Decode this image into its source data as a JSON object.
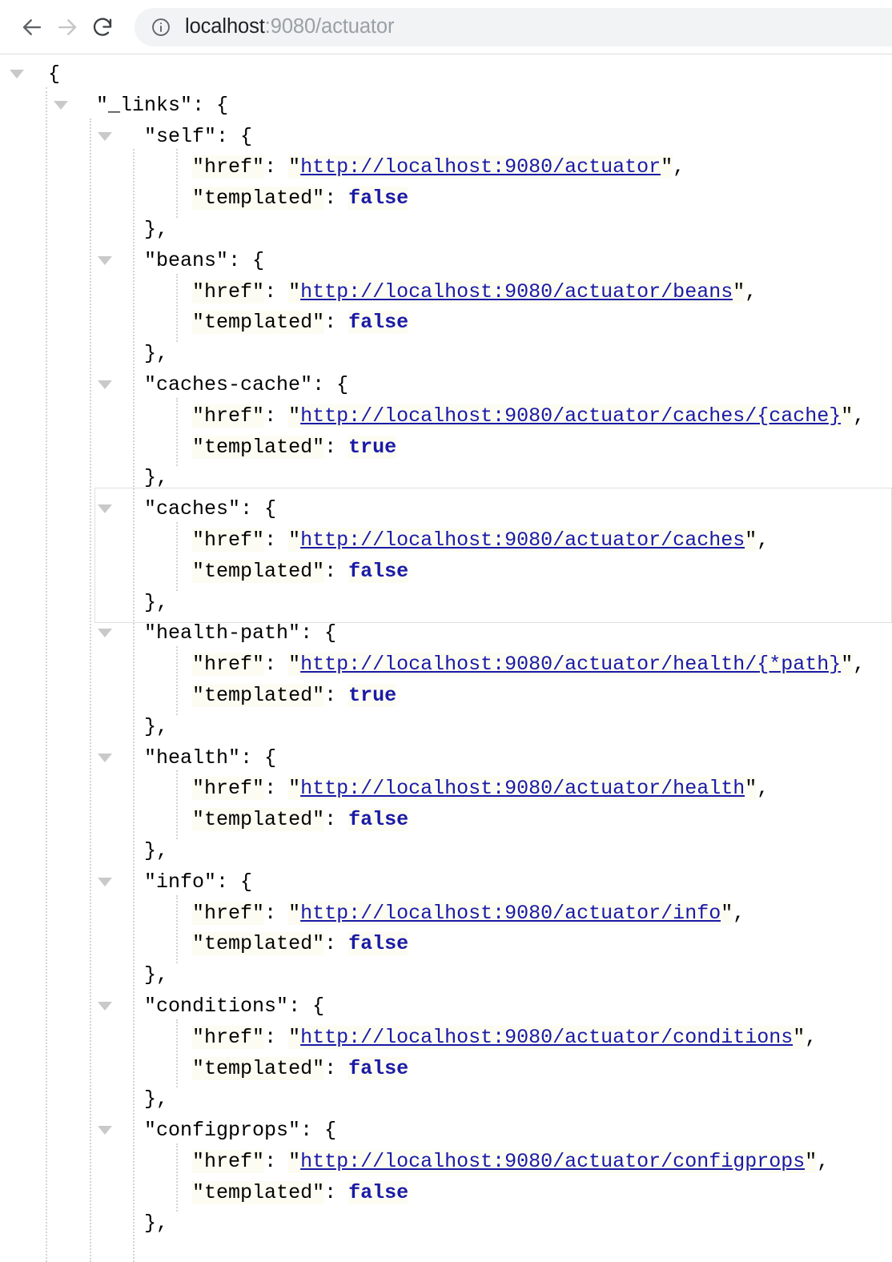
{
  "browser": {
    "back_label": "Back",
    "forward_label": "Forward",
    "reload_label": "Reload",
    "site_info_label": "View site information",
    "url_host": "localhost",
    "url_rest": ":9080/actuator",
    "url_full": "localhost:9080/actuator",
    "icons": {
      "back": "arrow-left-icon",
      "forward": "arrow-right-icon",
      "reload": "reload-icon",
      "site_info": "info-circle-icon"
    }
  },
  "json": {
    "root_open": "{",
    "links_key": "\"_links\"",
    "colon": ":",
    "brace_open": "{",
    "brace_close_comma": "},",
    "href_key": "\"href\"",
    "templated_key": "\"templated\"",
    "quote": "\"",
    "quote_comma": "\",",
    "entries": [
      {
        "name": "self",
        "key_text": "\"self\"",
        "href": "http://localhost:9080/actuator",
        "templated": "false",
        "highlighted": false
      },
      {
        "name": "beans",
        "key_text": "\"beans\"",
        "href": "http://localhost:9080/actuator/beans",
        "templated": "false",
        "highlighted": false
      },
      {
        "name": "caches-cache",
        "key_text": "\"caches-cache\"",
        "href": "http://localhost:9080/actuator/caches/{cache}",
        "templated": "true",
        "highlighted": false
      },
      {
        "name": "caches",
        "key_text": "\"caches\"",
        "href": "http://localhost:9080/actuator/caches",
        "templated": "false",
        "highlighted": true
      },
      {
        "name": "health-path",
        "key_text": "\"health-path\"",
        "href": "http://localhost:9080/actuator/health/{*path}",
        "templated": "true",
        "highlighted": false
      },
      {
        "name": "health",
        "key_text": "\"health\"",
        "href": "http://localhost:9080/actuator/health",
        "templated": "false",
        "highlighted": false
      },
      {
        "name": "info",
        "key_text": "\"info\"",
        "href": "http://localhost:9080/actuator/info",
        "templated": "false",
        "highlighted": false
      },
      {
        "name": "conditions",
        "key_text": "\"conditions\"",
        "href": "http://localhost:9080/actuator/conditions",
        "templated": "false",
        "highlighted": false
      },
      {
        "name": "configprops",
        "key_text": "\"configprops\"",
        "href": "http://localhost:9080/actuator/configprops",
        "templated": "false",
        "highlighted": false
      }
    ]
  }
}
